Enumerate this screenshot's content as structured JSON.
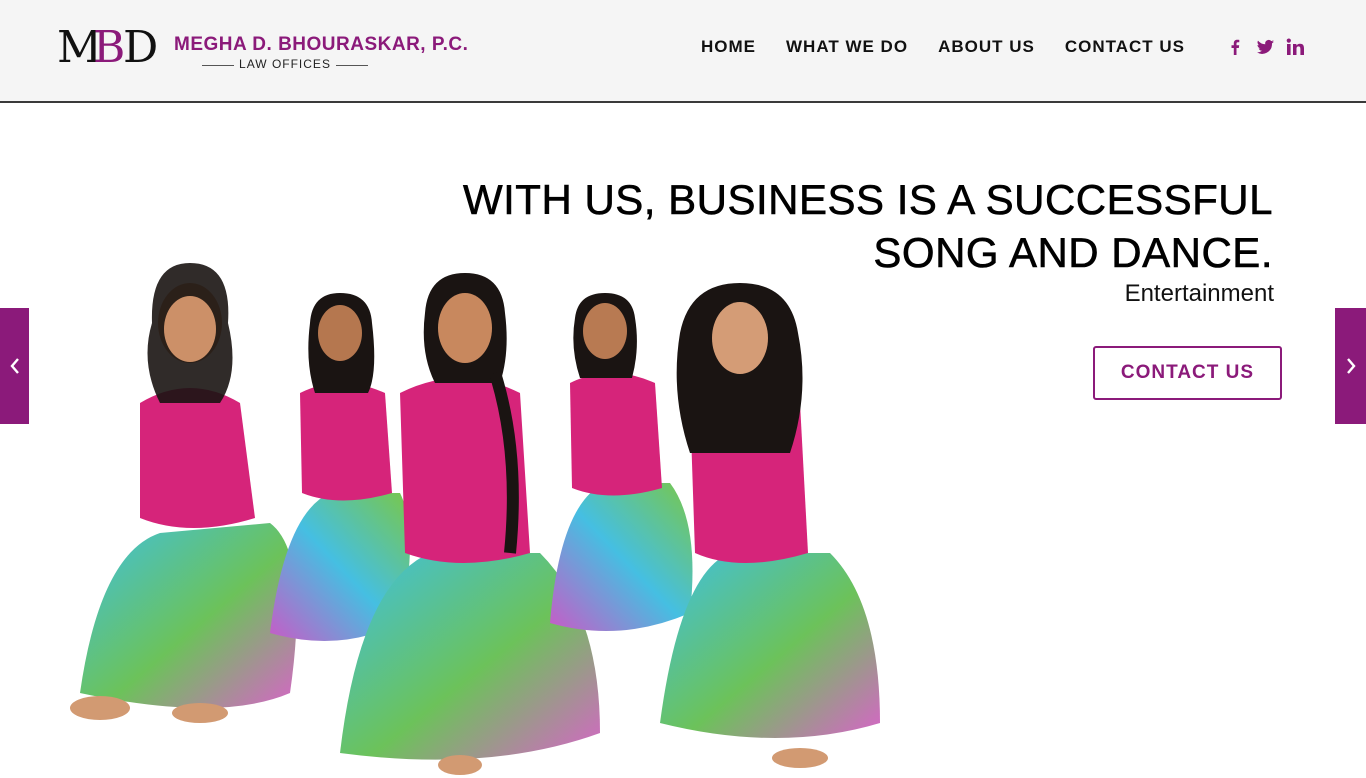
{
  "header": {
    "logo": {
      "mark_letters": [
        "M",
        "B",
        "D"
      ],
      "name": "MEGHA D. BHOURASKAR, P.C.",
      "subtitle": "LAW OFFICES"
    },
    "nav": [
      {
        "label": "HOME"
      },
      {
        "label": "WHAT WE DO"
      },
      {
        "label": "ABOUT US"
      },
      {
        "label": "CONTACT US"
      }
    ],
    "social": [
      {
        "icon": "facebook-icon"
      },
      {
        "icon": "twitter-icon"
      },
      {
        "icon": "linkedin-icon"
      }
    ]
  },
  "hero": {
    "headline_line1": "WITH US, BUSINESS IS A SUCCESSFUL",
    "headline_line2": "SONG AND DANCE.",
    "tagline": "Entertainment",
    "cta_label": "CONTACT US",
    "prev_icon": "chevron-left-icon",
    "next_icon": "chevron-right-icon"
  },
  "colors": {
    "brand": "#8b1a7a",
    "header_bg": "#f5f5f5",
    "text": "#111111"
  }
}
